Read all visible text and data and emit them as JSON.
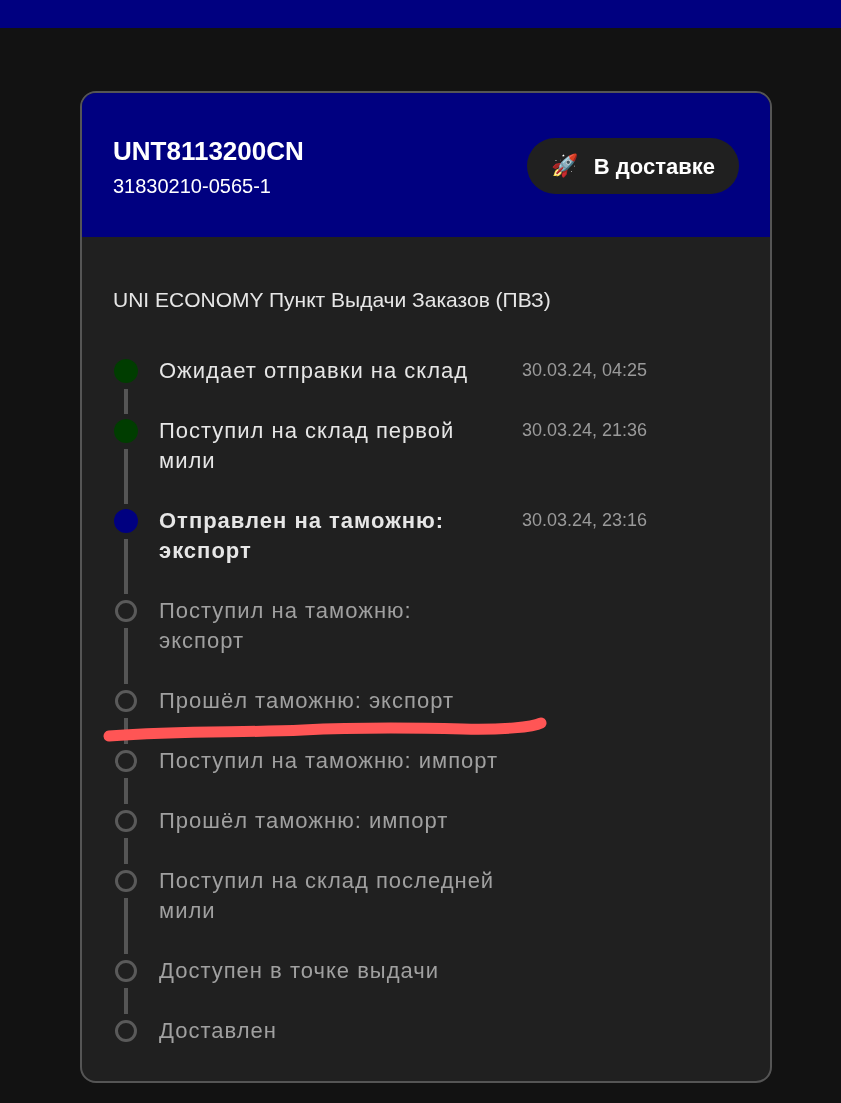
{
  "header": {
    "tracking_number": "UNT8113200CN",
    "order_number": "31830210-0565-1",
    "status_badge": {
      "icon": "🚀",
      "label": "В доставке"
    }
  },
  "service": "UNI ECONOMY Пункт Выдачи Заказов (ПВЗ)",
  "timeline": [
    {
      "label": "Ожидает отправки на склад",
      "date": "30.03.24, 04:25",
      "kind": "done"
    },
    {
      "label": "Поступил на склад первой мили",
      "date": "30.03.24, 21:36",
      "kind": "done"
    },
    {
      "label": "Отправлен на таможню: экспорт",
      "date": "30.03.24, 23:16",
      "kind": "current"
    },
    {
      "label": "Поступил на таможню: экспорт",
      "kind": "pending"
    },
    {
      "label": "Прошёл таможню: экспорт",
      "kind": "pending"
    },
    {
      "label": "Поступил на таможню: импорт",
      "kind": "pending"
    },
    {
      "label": "Прошёл таможню: импорт",
      "kind": "pending"
    },
    {
      "label": "Поступил на склад последней мили",
      "kind": "pending"
    },
    {
      "label": "Доступен в точке выдачи",
      "kind": "pending"
    },
    {
      "label": "Доставлен",
      "kind": "pending"
    }
  ]
}
